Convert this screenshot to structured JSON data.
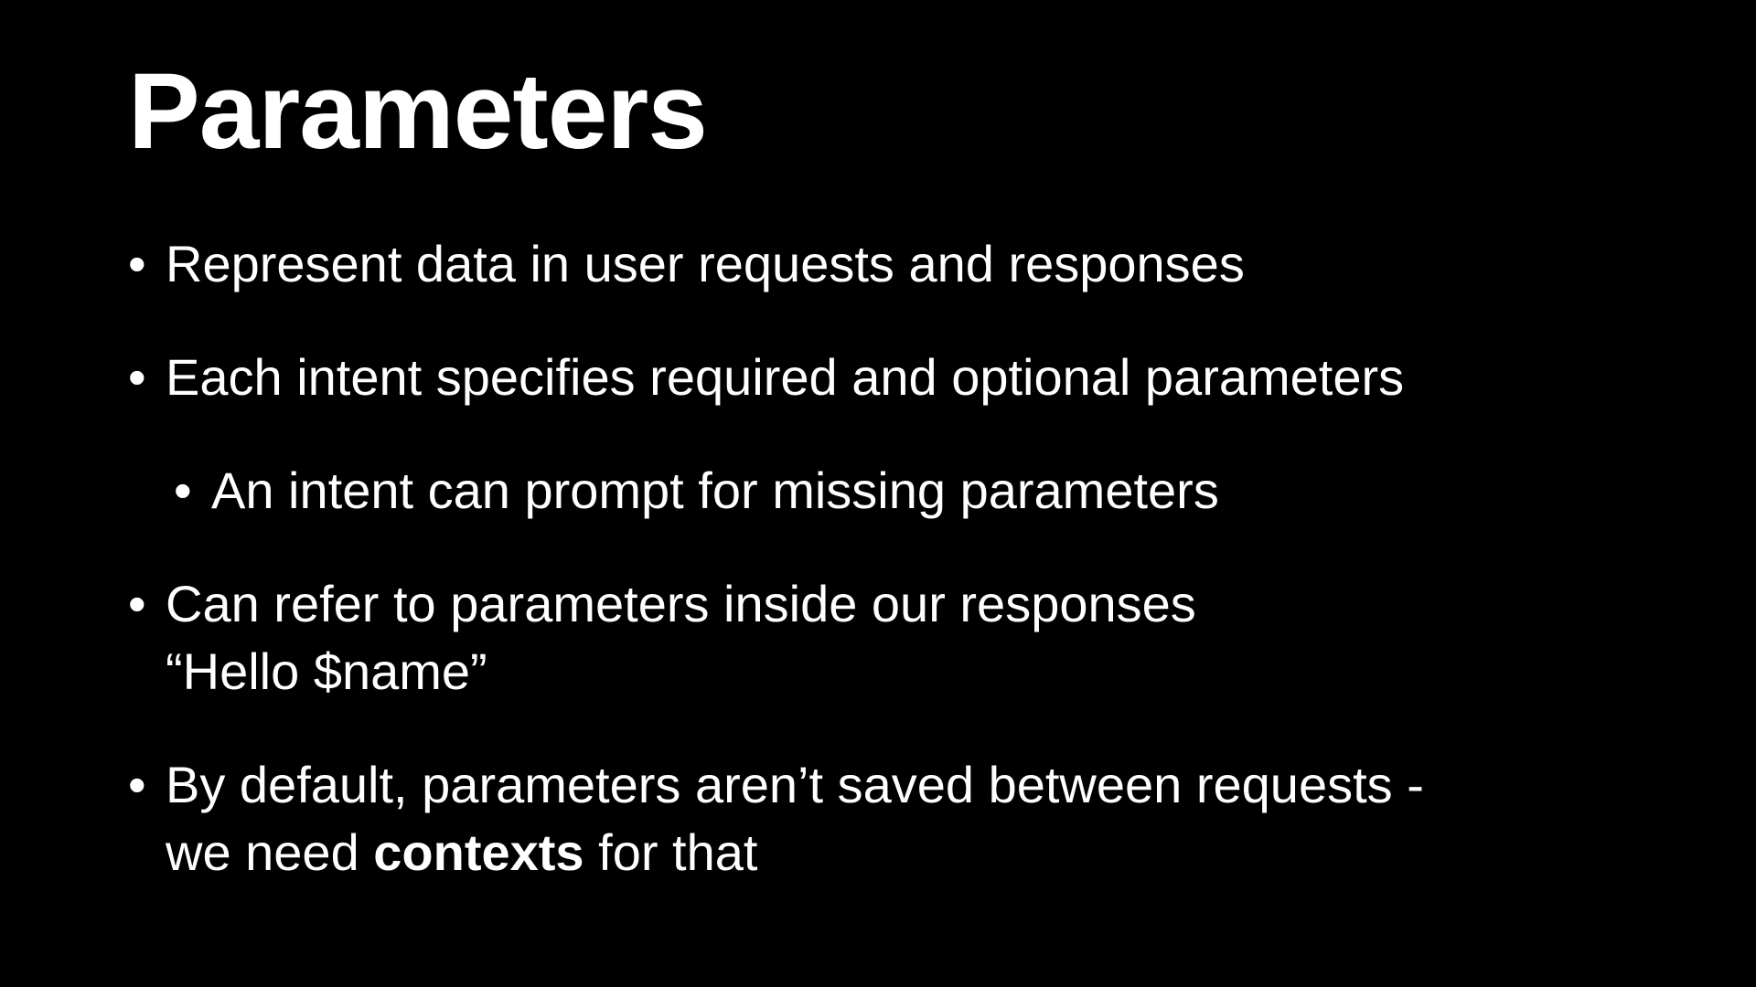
{
  "slide": {
    "title": "Parameters",
    "bullet_glyph": "•",
    "bullets": [
      {
        "text": "Represent data in user requests and responses"
      },
      {
        "text": "Each intent specifies required and optional parameters"
      },
      {
        "text": "An intent can prompt for missing parameters"
      },
      {
        "line1": "Can refer to parameters inside our responses",
        "line2": "“Hello $name”"
      },
      {
        "line1": "By default, parameters aren’t saved between requests -",
        "line2_prefix": "we need ",
        "line2_bold": "contexts",
        "line2_suffix": " for that"
      }
    ]
  }
}
